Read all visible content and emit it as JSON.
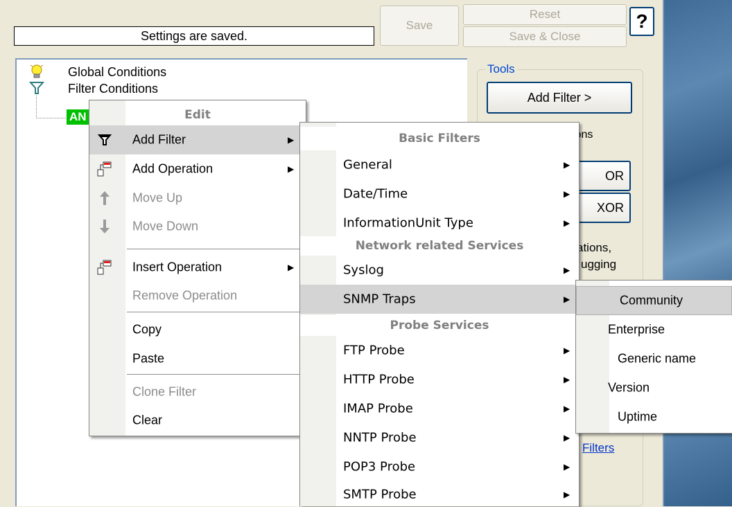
{
  "status_text": "Settings are saved.",
  "buttons": {
    "save": "Save",
    "reset": "Reset",
    "save_close": "Save & Close",
    "help": "?"
  },
  "tree": {
    "global": "Global Conditions",
    "filter": "Filter Conditions",
    "and_node": "AN"
  },
  "tools": {
    "legend": "Tools",
    "add_filter": "Add Filter >",
    "partial_ops": "ions",
    "or": "OR",
    "xor": "XOR",
    "partial_text1": "ations,",
    "partial_text2": "ugging",
    "filters_link": "Filters"
  },
  "edit_menu": {
    "header": "Edit",
    "items": {
      "add_filter": "Add Filter",
      "add_operation": "Add Operation",
      "move_up": "Move Up",
      "move_down": "Move Down",
      "insert_operation": "Insert Operation",
      "remove_operation": "Remove Operation",
      "copy": "Copy",
      "paste": "Paste",
      "clone_filter": "Clone Filter",
      "clear": "Clear"
    }
  },
  "filter_menu": {
    "header_basic": "Basic Filters",
    "general": "General",
    "datetime": "Date/Time",
    "infounit": "InformationUnit Type",
    "header_network": "Network related Services",
    "syslog": "Syslog",
    "snmp": "SNMP Traps",
    "header_probe": "Probe Services",
    "ftp": "FTP Probe",
    "http": "HTTP Probe",
    "imap": "IMAP Probe",
    "nntp": "NNTP Probe",
    "pop3": "POP3 Probe",
    "smtp": "SMTP Probe"
  },
  "snmp_menu": {
    "community": "Community",
    "enterprise": "Enterprise",
    "generic": "Generic name",
    "version": "Version",
    "uptime": "Uptime"
  },
  "icons": {
    "global": "lightbulb-icon",
    "filter": "funnel-icon",
    "add_filter": "funnel-icon",
    "add_operation": "operation-icon",
    "move_up": "arrow-up-icon",
    "move_down": "arrow-down-icon",
    "insert_operation": "operation-icon",
    "submenu": "triangle-right-icon"
  },
  "colors": {
    "highlight": "#d4d4d4",
    "and_node": "#00c000",
    "link": "#0033cc"
  }
}
